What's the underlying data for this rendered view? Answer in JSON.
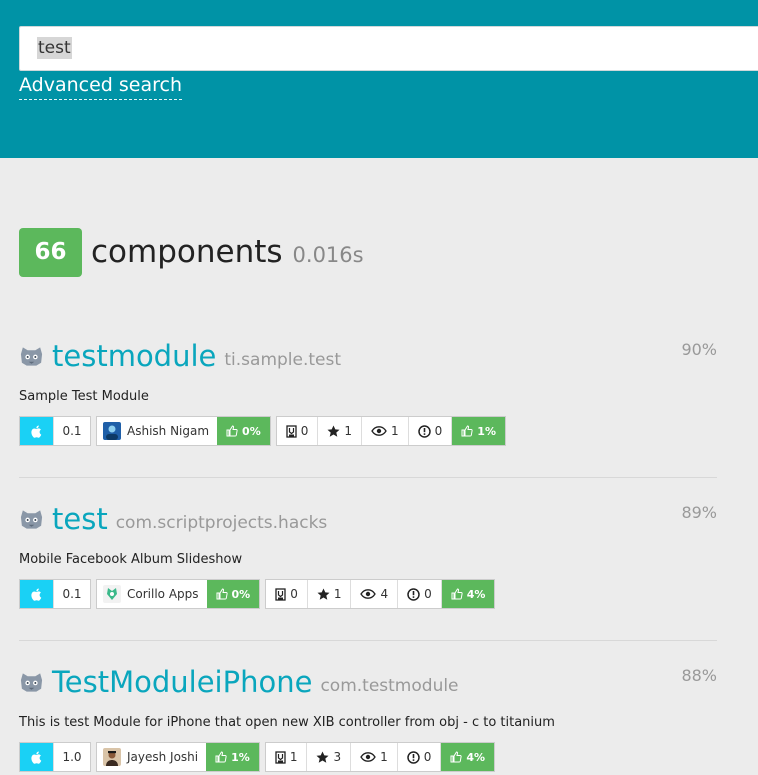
{
  "search": {
    "query": "test",
    "advanced_label": "Advanced search"
  },
  "summary": {
    "count": "66",
    "label": "components",
    "time": "0.016s"
  },
  "colors": {
    "header": "#0093a6",
    "accent": "#0aa6bd",
    "success": "#5cb85c",
    "platform": "#1ad1f5"
  },
  "results": [
    {
      "name": "testmodule",
      "id": "ti.sample.test",
      "score": "90%",
      "description": "Sample Test Module",
      "platform_icon": "apple-icon",
      "version": "0.1",
      "author": "Ashish Nigam",
      "author_likes": "0%",
      "downloads": "0",
      "stars": "1",
      "views": "1",
      "issues": "0",
      "likes": "1%"
    },
    {
      "name": "test",
      "id": "com.scriptprojects.hacks",
      "score": "89%",
      "description": "Mobile Facebook Album Slideshow",
      "platform_icon": "apple-icon",
      "version": "0.1",
      "author": "Corillo Apps",
      "author_likes": "0%",
      "downloads": "0",
      "stars": "1",
      "views": "4",
      "issues": "0",
      "likes": "4%"
    },
    {
      "name": "TestModuleiPhone",
      "id": "com.testmodule",
      "score": "88%",
      "description": "This is test Module for iPhone that open new XIB controller from obj - c to titanium",
      "platform_icon": "apple-icon",
      "version": "1.0",
      "author": "Jayesh Joshi",
      "author_likes": "1%",
      "downloads": "1",
      "stars": "3",
      "views": "1",
      "issues": "0",
      "likes": "4%"
    }
  ]
}
